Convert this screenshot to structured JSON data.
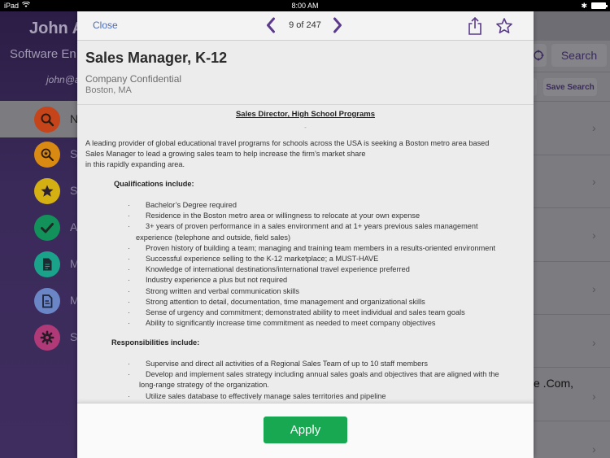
{
  "status_bar": {
    "device": "iPad",
    "time": "8:00 AM"
  },
  "sidebar": {
    "user_name": "John A",
    "user_role": "Software En",
    "user_email": "john@a",
    "items": [
      {
        "icon": "search-icon",
        "label": "N",
        "color": "#c5441a",
        "active": true
      },
      {
        "icon": "saved-search-icon",
        "label": "S",
        "color": "#d98a12"
      },
      {
        "icon": "star-icon",
        "label": "S",
        "color": "#d4b012"
      },
      {
        "icon": "checkmark-icon",
        "label": "A",
        "color": "#12925a"
      },
      {
        "icon": "document-icon",
        "label": "M",
        "color": "#1aa38a"
      },
      {
        "icon": "resume-icon",
        "label": "M",
        "color": "#6a86c6"
      },
      {
        "icon": "gear-icon",
        "label": "S",
        "color": "#b03a78"
      }
    ]
  },
  "background_list": {
    "search_label": "Search",
    "save_search_label": "Save Search",
    "partial_row_text": "e .Com,"
  },
  "modal": {
    "close_label": "Close",
    "counter": "9 of 247",
    "accent_color": "#5b3a8c",
    "job_title": "Sales Manager, K-12",
    "company": "Company Confidential",
    "location": "Boston, MA",
    "doc_heading": "Sales Director, High School Programs",
    "intro_lines": [
      "A leading provider of global educational travel programs for schools across the USA is seeking a Boston metro area based",
      "Sales Manager to lead a growing sales team to help increase the firm’s market share",
      "in this rapidly expanding area."
    ],
    "qualifications_title": "Qualifications include:",
    "qualifications": [
      "Bachelor’s Degree required",
      "Residence in the Boston metro area or willingness to relocate at your own expense",
      "3+ years of proven performance in a sales environment and at 1+ years previous sales management",
      "experience (telephone and outside, field sales)",
      "Proven history of building a team; managing and training team members in a results-oriented environment",
      "Successful experience selling to the K-12 marketplace; a MUST-HAVE",
      "Knowledge of international destinations/international travel experience preferred",
      "Industry experience a plus but not required",
      "Strong written and verbal communication skills",
      "Strong attention to detail, documentation, time management and organizational skills",
      "Sense of urgency and commitment; demonstrated ability to meet individual and sales team goals",
      "Ability to significantly increase time commitment as needed to meet company objectives"
    ],
    "responsibilities_title": "Responsibilities include:",
    "responsibilities": [
      "Supervise and direct all activities of a Regional Sales Team of up to 10 staff members",
      "Develop and implement sales strategy including annual sales goals and objectives that are aligned with the",
      "long-range strategy of the organization.",
      "Utilize sales database to effectively manage sales territories and pipeline"
    ],
    "apply_label": "Apply",
    "apply_color": "#17a851"
  }
}
